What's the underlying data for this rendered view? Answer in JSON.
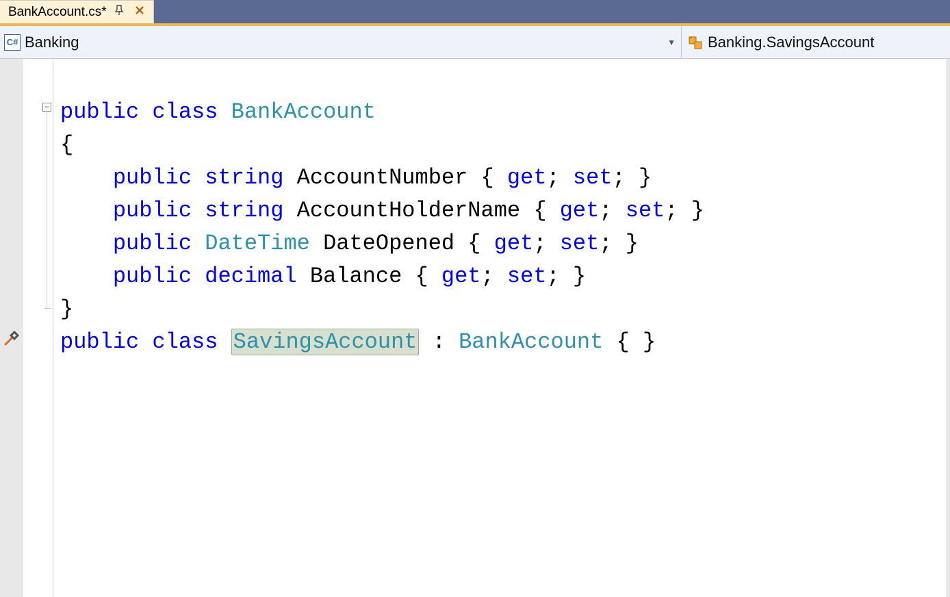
{
  "tabs": {
    "active": {
      "title": "BankAccount.cs*"
    }
  },
  "nav": {
    "left_label": "Banking",
    "right_label": "Banking.SavingsAccount",
    "csharp_badge": "C#"
  },
  "code": {
    "l1": {
      "kw1": "public",
      "kw2": "class",
      "name": "BankAccount"
    },
    "l2": "{",
    "props": [
      {
        "mod": "public",
        "type": "string",
        "name": "AccountNumber",
        "get": "get",
        "set": "set"
      },
      {
        "mod": "public",
        "type": "string",
        "name": "AccountHolderName",
        "get": "get",
        "set": "set"
      },
      {
        "mod": "public",
        "type": "DateTime",
        "name": "DateOpened",
        "get": "get",
        "set": "set"
      },
      {
        "mod": "public",
        "type": "decimal",
        "name": "Balance",
        "get": "get",
        "set": "set"
      }
    ],
    "l7": "}",
    "l8": {
      "kw1": "public",
      "kw2": "class",
      "name": "SavingsAccount",
      "colon": ":",
      "base": "BankAccount",
      "body": "{ }"
    }
  },
  "glyphs": {
    "fold_minus": "−"
  }
}
